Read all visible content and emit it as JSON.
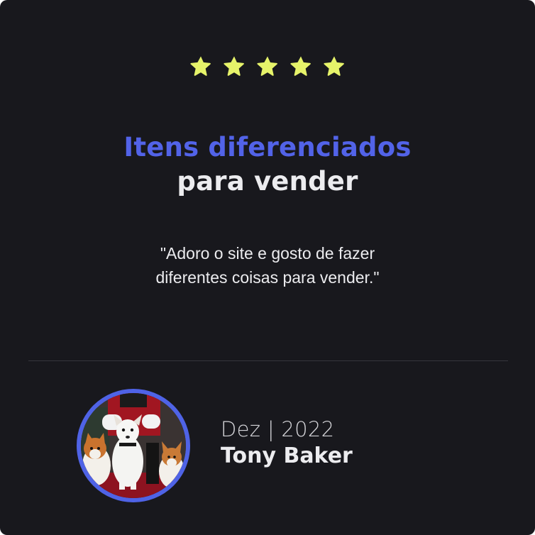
{
  "rating": {
    "value": 5,
    "max": 5,
    "star_color": "#e6f36a"
  },
  "headline": {
    "line1": "Itens diferenciados",
    "line2": "para vender",
    "accent_color": "#5263e8"
  },
  "quote": {
    "line1": "\"Adoro o site e gosto de fazer",
    "line2": "diferentes coisas para vender.\""
  },
  "author": {
    "date": "Dez | 2022",
    "name": "Tony Baker",
    "avatar_icon": "avatar-photo-dogs",
    "avatar_ring_color": "#4f63e6"
  }
}
